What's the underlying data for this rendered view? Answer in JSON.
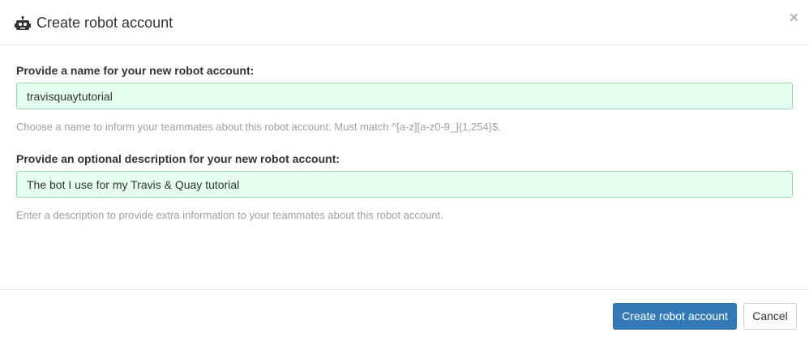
{
  "header": {
    "title": "Create robot account",
    "icon": "robot-icon",
    "close_label": "×"
  },
  "form": {
    "name": {
      "label": "Provide a name for your new robot account:",
      "value": "travisquaytutorial",
      "help": "Choose a name to inform your teammates about this robot account. Must match ^[a-z][a-z0-9_]{1,254}$."
    },
    "description": {
      "label": "Provide an optional description for your new robot account:",
      "value": "The bot I use for my Travis & Quay tutorial",
      "help": "Enter a description to provide extra information to your teammates about this robot account."
    }
  },
  "footer": {
    "create_label": "Create robot account",
    "cancel_label": "Cancel"
  },
  "colors": {
    "primary": "#337ab7",
    "input_valid_bg": "#e5fff0",
    "input_valid_border": "#9bd3ab"
  }
}
